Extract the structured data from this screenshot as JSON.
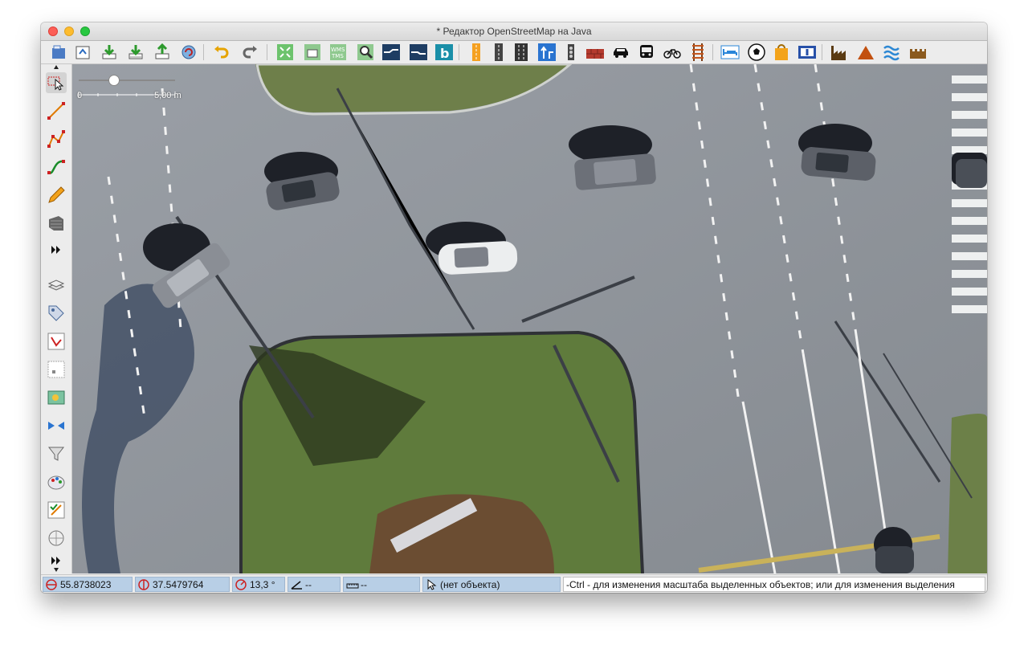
{
  "window": {
    "title": "* Редактор OpenStreetMap на Java"
  },
  "toolbar": {
    "buttons": [
      "open-file-icon",
      "open-location-icon",
      "download-icon",
      "download-along-icon",
      "upload-icon",
      "update-data-icon",
      "undo-icon",
      "redo-icon",
      "zoom-to-data-icon",
      "imagery-wms-icon",
      "imagery-tms-icon",
      "search-icon",
      "imagery-layer-icon",
      "imagery-layer-2-icon",
      "bing-icon",
      "preset-road-icon",
      "preset-road-dark-icon",
      "preset-road-lanes-icon",
      "preset-oneway-icon",
      "preset-traffic-signals-icon",
      "preset-wall-icon",
      "preset-car-icon",
      "preset-bus-icon",
      "preset-bicycle-icon",
      "preset-railway-icon",
      "preset-hotel-icon",
      "preset-soccer-icon",
      "preset-shop-icon",
      "preset-info-icon",
      "preset-industrial-icon",
      "preset-peak-icon",
      "preset-water-icon",
      "preset-castle-icon"
    ]
  },
  "left_tools": [
    "select-icon",
    "draw-line-icon",
    "draw-way-icon",
    "improve-way-icon",
    "pencil-icon",
    "building-icon",
    "more-tools-icon",
    "layers-icon",
    "tags-icon",
    "relation-icon",
    "selection-icon",
    "imagery-icon",
    "conflict-icon",
    "filter-icon",
    "map-paint-icon",
    "validator-icon",
    "globe-icon",
    "more-dialogs-icon"
  ],
  "map": {
    "scale_zero": "0",
    "scale_label": "5,00 m",
    "zoom_level": 0.37
  },
  "status": {
    "lat": "55.8738023",
    "lon": "37.5479764",
    "heading": "13,3 °",
    "angle": "--",
    "distance": "--",
    "object": "(нет объекта)",
    "message": "-Ctrl - для изменения масштаба выделенных объектов; или для изменения выделения"
  },
  "colors": {
    "status_field": "#b8cfe6",
    "grass": "#5f7b3c",
    "road": "#8e949b"
  }
}
